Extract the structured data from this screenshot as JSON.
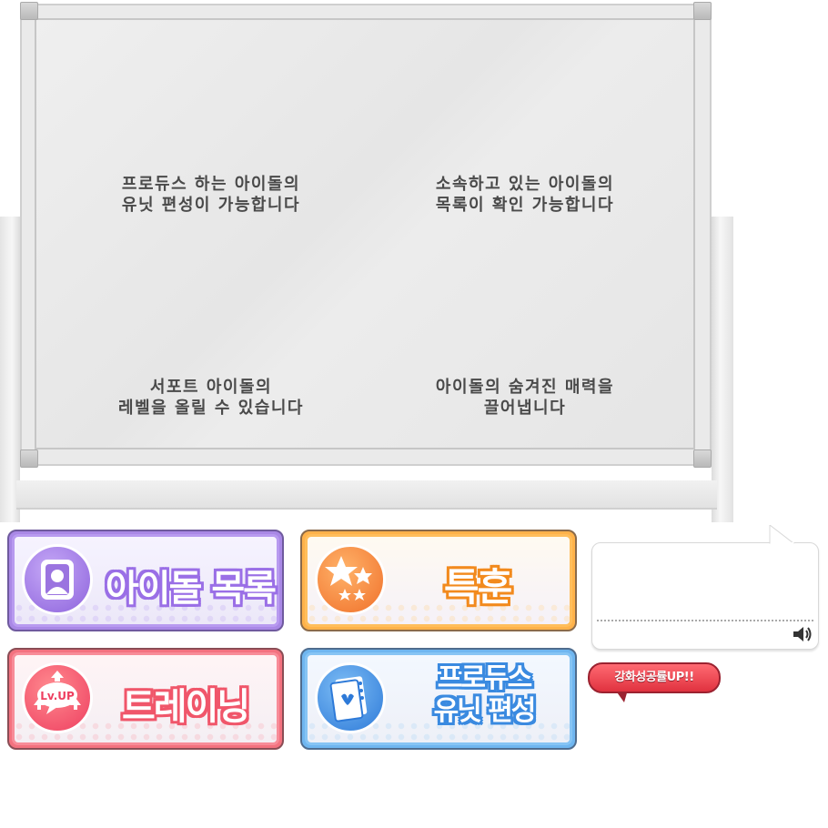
{
  "board": {
    "texts": [
      {
        "line1": "프로듀스 하는 아이돌의",
        "line2": "유닛 편성이 가능합니다"
      },
      {
        "line1": "소속하고 있는 아이돌의",
        "line2": "목록이 확인 가능합니다"
      },
      {
        "line1": "서포트 아이돌의",
        "line2": "레벨을 올릴 수 있습니다"
      },
      {
        "line1": "아이돌의 숨겨진 매력을",
        "line2": "끌어냅니다"
      }
    ]
  },
  "menu": {
    "idol_list": {
      "label": "아이돌 목록",
      "color": "#9a6fe6"
    },
    "special_training": {
      "label": "특훈",
      "color": "#f28a1d"
    },
    "training": {
      "label": "트레이닝",
      "icon_text": "Lv.UP",
      "color": "#f0566a"
    },
    "unit_formation": {
      "line1": "프로듀스",
      "line2": "유닛 편성",
      "color": "#3a8ae0"
    }
  },
  "speech": {
    "text": "",
    "sound_icon": "speaker-icon"
  },
  "badge": {
    "label": "강화성공률UP!!",
    "color": "#e0323f"
  }
}
